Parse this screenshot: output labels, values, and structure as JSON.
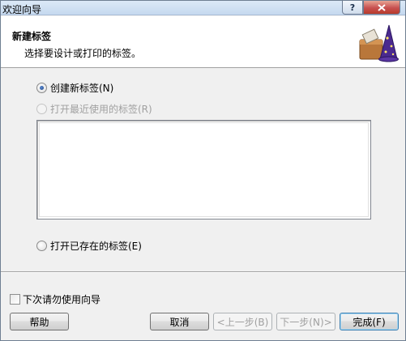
{
  "window": {
    "title": "欢迎向导",
    "help_button": "?"
  },
  "header": {
    "title": "新建标签",
    "subtitle": "选择要设计或打印的标签。"
  },
  "options": {
    "create_new": "创建新标签(N)",
    "open_recent": "打开最近使用的标签(R)",
    "open_existing": "打开已存在的标签(E)"
  },
  "footer": {
    "dont_show_label": "下次请勿使用向导"
  },
  "buttons": {
    "help": "帮助",
    "cancel": "取消",
    "back": "<上一步(B)",
    "next": "下一步(N)>",
    "finish": "完成(F)"
  },
  "state": {
    "selected_option": "create_new",
    "dont_show_checked": false,
    "recent_enabled": false,
    "back_enabled": false,
    "next_enabled": false
  },
  "colors": {
    "close_button": "#c75050",
    "accent": "#3c7fb1"
  }
}
